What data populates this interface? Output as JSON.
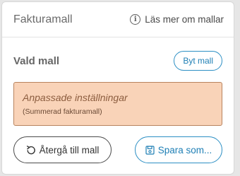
{
  "header": {
    "title": "Fakturamall",
    "info_label": "Läs mer om mallar",
    "info_icon": "info-icon"
  },
  "selected": {
    "label": "Vald mall",
    "change_button": "Byt mall"
  },
  "template": {
    "name": "Anpassade inställningar",
    "description": "(Summerad fakturamall)"
  },
  "actions": {
    "revert_label": "Återgå till mall",
    "revert_icon": "undo-icon",
    "save_label": "Spara som...",
    "save_icon": "save-icon"
  },
  "colors": {
    "accent": "#1e7fb5",
    "template_bg": "#f9d3b8",
    "template_border": "#b8835e"
  }
}
